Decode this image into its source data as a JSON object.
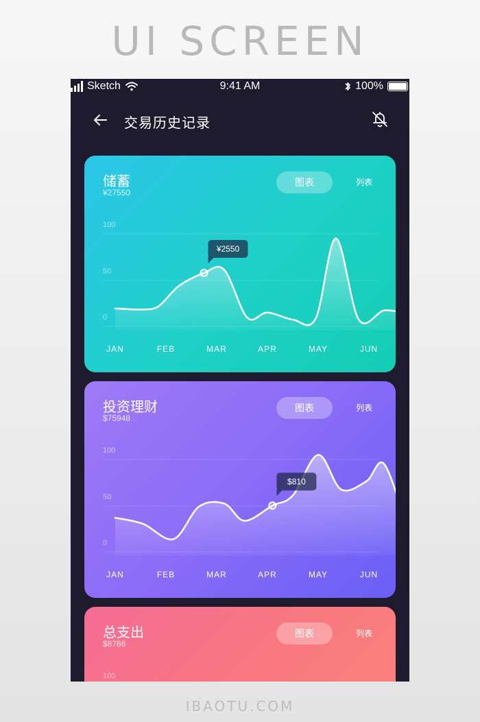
{
  "banner": {
    "title": "UI SCREEN",
    "footer": "IBAOTU.COM"
  },
  "status_bar": {
    "carrier": "Sketch",
    "time": "9:41 AM",
    "battery": "100%"
  },
  "nav": {
    "title": "交易历史记录",
    "icons": [
      "back-arrow-icon",
      "bell-off-icon"
    ]
  },
  "cards": [
    {
      "title": "储蓄",
      "amount": "¥27550",
      "tab_chart": "图表",
      "tab_list": "列表",
      "colors": [
        "#2cc6ea",
        "#14cdb4"
      ]
    },
    {
      "title": "投资理财",
      "amount": "$75948",
      "tab_chart": "图表",
      "tab_list": "列表",
      "colors": [
        "#a07af6",
        "#6a5ff6"
      ]
    },
    {
      "title": "总支出",
      "amount": "$8786",
      "tab_chart": "图表",
      "tab_list": "列表",
      "colors": [
        "#f66c95",
        "#fa837a"
      ]
    }
  ],
  "chart_data": [
    {
      "type": "area",
      "categories": [
        "JAN",
        "FEB",
        "MAR",
        "APR",
        "MAY",
        "JUN"
      ],
      "yticks": [
        "100",
        "50",
        "0"
      ],
      "ylim": [
        0,
        100
      ],
      "grid": true,
      "x": [
        0,
        0.5,
        0.85,
        1.25,
        1.75,
        2.15,
        2.6,
        3.0,
        3.5,
        3.95,
        4.35,
        4.8,
        5.3,
        5.75
      ],
      "values": [
        17,
        16,
        19,
        39,
        52,
        55,
        8,
        13,
        6,
        7,
        86,
        6,
        15,
        12
      ],
      "highlight": {
        "x": 1.75,
        "y": 52,
        "label": "¥2550"
      }
    },
    {
      "type": "area",
      "categories": [
        "JAN",
        "FEB",
        "MAR",
        "APR",
        "MAY",
        "JUN"
      ],
      "yticks": [
        "100",
        "50",
        "0"
      ],
      "ylim": [
        0,
        100
      ],
      "grid": true,
      "x": [
        0,
        0.55,
        1.15,
        1.65,
        2.15,
        2.55,
        3.1,
        3.5,
        4.0,
        4.45,
        4.95,
        5.3,
        5.75
      ],
      "values": [
        33,
        27,
        12,
        44,
        47,
        30,
        45,
        55,
        95,
        61,
        69,
        86,
        24
      ],
      "highlight": {
        "x": 3.1,
        "y": 45,
        "label": "$810"
      }
    }
  ]
}
